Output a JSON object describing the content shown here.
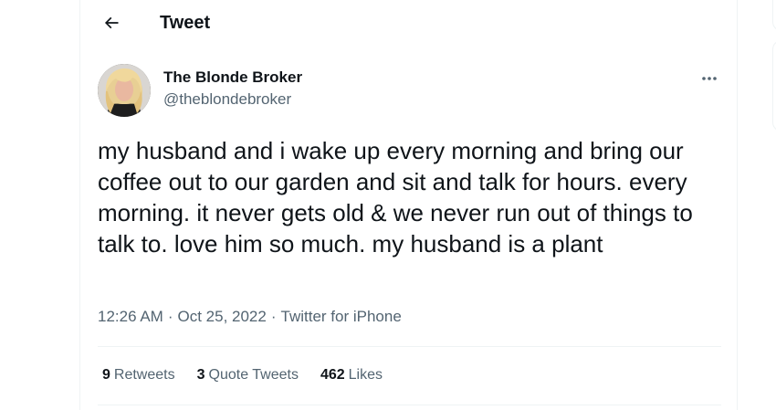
{
  "header": {
    "title": "Tweet"
  },
  "author": {
    "display_name": "The Blonde Broker",
    "handle": "@theblondebroker"
  },
  "tweet": {
    "text": "my husband and i wake up every morning and bring our coffee out to our garden and sit and talk for hours. every morning. it never gets old & we never run out of things to talk to. love him so much. my husband is a plant",
    "time": "12:26 AM",
    "date": "Oct 25, 2022",
    "source": "Twitter for iPhone",
    "separator": "·"
  },
  "stats": {
    "retweets_count": "9",
    "retweets_label": "Retweets",
    "quotes_count": "3",
    "quotes_label": "Quote Tweets",
    "likes_count": "462",
    "likes_label": "Likes"
  },
  "icons": {
    "back": "arrow-left-icon",
    "more": "more-horizontal-icon"
  },
  "colors": {
    "text_primary": "#0f1419",
    "text_secondary": "#536471",
    "border": "#eff3f4"
  }
}
